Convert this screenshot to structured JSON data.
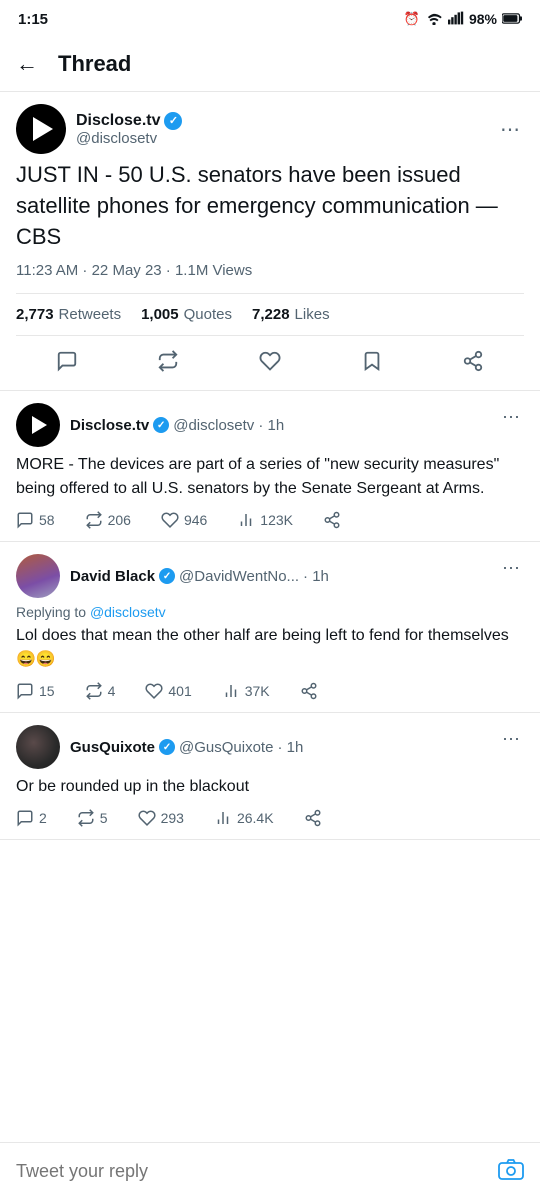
{
  "status": {
    "time": "1:15",
    "alarm": "⏰",
    "wifi": "WiFi",
    "signal": "signal",
    "battery": "98%"
  },
  "header": {
    "back": "←",
    "title": "Thread"
  },
  "main_tweet": {
    "author_name": "Disclose.tv",
    "author_handle": "@disclosetv",
    "text": "JUST IN - 50 U.S. senators have been issued satellite phones for emergency communication — CBS",
    "meta": "11:23 AM · 22 May 23 · 1.1M Views",
    "retweets_num": "2,773",
    "retweets_label": "Retweets",
    "quotes_num": "1,005",
    "quotes_label": "Quotes",
    "likes_num": "7,228",
    "likes_label": "Likes"
  },
  "actions": {
    "comment_icon": "💬",
    "retweet_icon": "🔁",
    "heart_icon": "♡",
    "bookmark_icon": "🔖",
    "share_icon": "↗"
  },
  "replies": [
    {
      "id": "reply1",
      "author_name": "Disclose.tv",
      "author_handle": "@disclosetv",
      "time": "1h",
      "text": "MORE - The devices are part of a series of \"new security measures\" being offered to all U.S. senators by the Senate Sergeant at Arms.",
      "comments": "58",
      "retweets": "206",
      "likes": "946",
      "views": "123K",
      "verified": true,
      "avatar_type": "play"
    },
    {
      "id": "reply2",
      "author_name": "David Black",
      "author_handle": "@DavidWentNo...",
      "time": "1h",
      "replying_to": "@disclosetv",
      "text": "Lol does that mean the other half are being left to fend for themselves 😄😄",
      "comments": "15",
      "retweets": "4",
      "likes": "401",
      "views": "37K",
      "verified": true,
      "avatar_type": "david"
    },
    {
      "id": "reply3",
      "author_name": "GusQuixote",
      "author_handle": "@GusQuixote",
      "time": "1h",
      "text": "Or be rounded up in the blackout",
      "comments": "2",
      "retweets": "5",
      "likes": "293",
      "views": "26.4K",
      "verified": true,
      "avatar_type": "gus"
    }
  ],
  "reply_bar": {
    "placeholder": "Tweet your reply",
    "camera_icon": "📷"
  }
}
